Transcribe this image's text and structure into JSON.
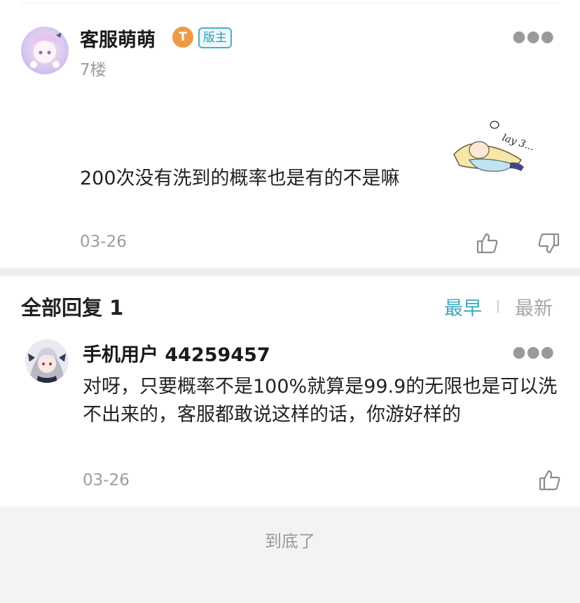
{
  "post": {
    "username": "客服萌萌",
    "level_badge": "T",
    "role_badge": "版主",
    "floor": "7楼",
    "text": "200次没有洗到的概率也是有的不是嘛",
    "date": "03-26",
    "sticker_text": "lay 3..."
  },
  "replies_section": {
    "title": "全部回复 1",
    "sort_earliest": "最早",
    "sort_newest": "最新",
    "accent_color": "#3ea8bd"
  },
  "reply": {
    "username": "手机用户 44259457",
    "text": "对呀，只要概率不是100%就算是99.9的无限也是可以洗不出来的，客服都敢说这样的话，你游好样的",
    "date": "03-26"
  },
  "footer": {
    "end_text": "到底了"
  },
  "icons": [
    "more-icon",
    "thumbs-up-icon",
    "thumbs-down-icon",
    "level-badge-icon"
  ]
}
